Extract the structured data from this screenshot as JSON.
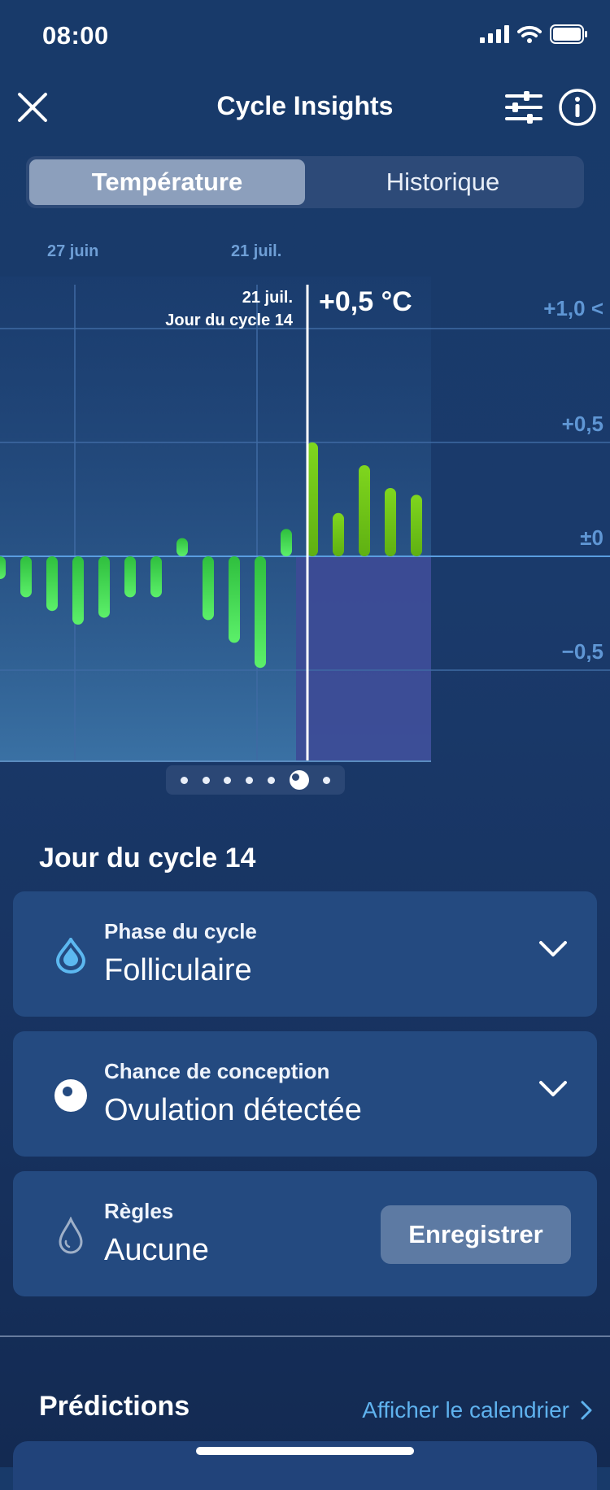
{
  "status_bar": {
    "time": "08:00"
  },
  "header": {
    "title": "Cycle Insights"
  },
  "tabs": [
    {
      "label": "Température",
      "active": true
    },
    {
      "label": "Historique",
      "active": false
    }
  ],
  "chart": {
    "date_labels": [
      "27 juin",
      "21 juil."
    ],
    "selected": {
      "date": "21 juil.",
      "cycle_day": "Jour du cycle 14",
      "value": "+0,5 °C"
    },
    "y_labels": [
      "+1,0 <",
      "+0,5",
      "±0",
      "−0,5"
    ]
  },
  "chart_data": {
    "type": "bar",
    "title": "",
    "ylabel": "",
    "ylim": [
      -0.95,
      1.1
    ],
    "y_ticks": [
      "+1,0",
      "+0,5",
      "±0",
      "−0,5"
    ],
    "values": [
      -0.1,
      -0.18,
      -0.24,
      -0.3,
      -0.27,
      -0.18,
      -0.18,
      0.08,
      -0.28,
      -0.38,
      -0.49,
      0.12,
      0.5,
      0.19,
      0.4,
      0.3,
      0.27
    ],
    "selected_index": 12,
    "colors": {
      "bar_low": "#3bef5a",
      "bar_high": "#6cc016",
      "luteal_zone": "#3d4a96"
    }
  },
  "pager": {
    "count": 7,
    "active_index": 5
  },
  "day": {
    "title": "Jour du cycle 14",
    "phase": {
      "label": "Phase du cycle",
      "value": "Folliculaire"
    },
    "conception": {
      "label": "Chance de conception",
      "value": "Ovulation détectée"
    },
    "period": {
      "label": "Règles",
      "value": "Aucune",
      "button": "Enregistrer"
    }
  },
  "predictions": {
    "title": "Prédictions",
    "link": "Afficher le calendrier"
  },
  "icons": [
    "close-icon",
    "filter-sliders-icon",
    "info-icon",
    "drop-icon",
    "eye-icon",
    "drop-outline-icon",
    "chevron-down-icon",
    "chevron-right-icon"
  ]
}
